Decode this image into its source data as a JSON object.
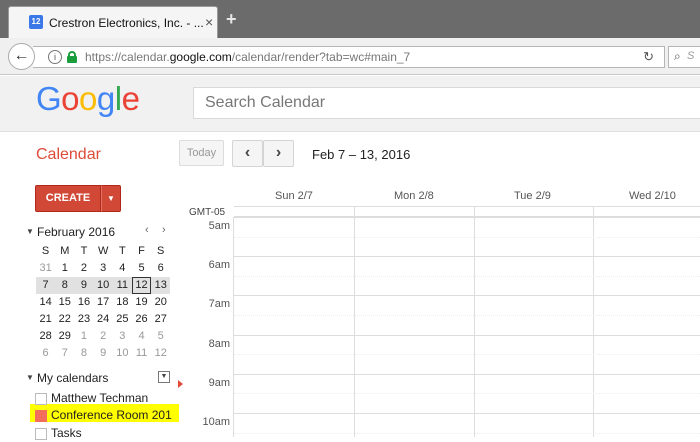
{
  "browser": {
    "tab_favicon": "12",
    "tab_title": "Crestron Electronics, Inc. - ...",
    "tab_close": "×",
    "new_tab": "+",
    "url_prefix": "https://calendar.",
    "url_domain": "google.com",
    "url_path": "/calendar/render?tab=wc#main_7",
    "search_hint": "S"
  },
  "header": {
    "logo": [
      "G",
      "o",
      "o",
      "g",
      "l",
      "e"
    ],
    "search_placeholder": "Search Calendar"
  },
  "toolbar": {
    "title": "Calendar",
    "today": "Today",
    "prev": "‹",
    "next": "›",
    "date_range": "Feb 7 – 13, 2016"
  },
  "sidebar": {
    "create": "CREATE",
    "create_dropdown": "▼",
    "mini_calendar": {
      "month": "February 2016",
      "prev": "‹",
      "next": "›",
      "dow": [
        "S",
        "M",
        "T",
        "W",
        "T",
        "F",
        "S"
      ],
      "weeks": [
        [
          "31",
          "1",
          "2",
          "3",
          "4",
          "5",
          "6"
        ],
        [
          "7",
          "8",
          "9",
          "10",
          "11",
          "12",
          "13"
        ],
        [
          "14",
          "15",
          "16",
          "17",
          "18",
          "19",
          "20"
        ],
        [
          "21",
          "22",
          "23",
          "24",
          "25",
          "26",
          "27"
        ],
        [
          "28",
          "29",
          "1",
          "2",
          "3",
          "4",
          "5"
        ],
        [
          "6",
          "7",
          "8",
          "9",
          "10",
          "11",
          "12"
        ]
      ],
      "selected_week_index": 1,
      "today_day": "12"
    },
    "my_calendars": {
      "label": "My calendars",
      "items": [
        {
          "name": "Matthew Techman",
          "color": "#ffffff"
        },
        {
          "name": "Conference Room 201",
          "color": "#f26d5b"
        },
        {
          "name": "Tasks",
          "color": "#ffffff"
        }
      ]
    }
  },
  "week": {
    "timezone": "GMT-05",
    "days": [
      "Sun 2/7",
      "Mon 2/8",
      "Tue 2/9",
      "Wed 2/10"
    ],
    "hours": [
      "5am",
      "6am",
      "7am",
      "8am",
      "9am",
      "10am"
    ]
  },
  "colors": {
    "accent_red": "#dd4b39",
    "create_button": "#d14836",
    "highlight": "#ffff00"
  }
}
